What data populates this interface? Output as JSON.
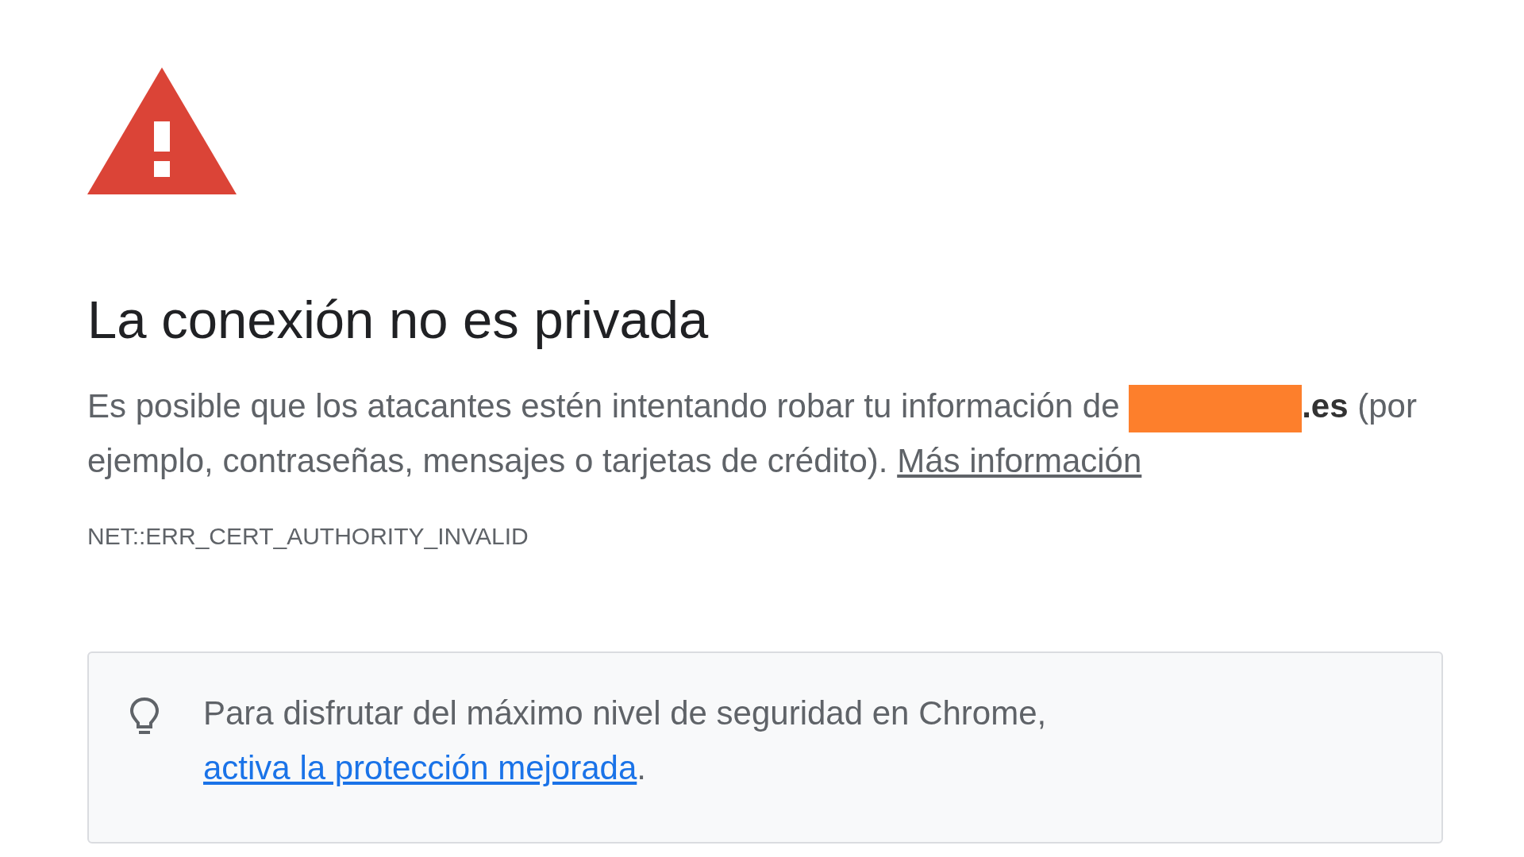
{
  "heading": "La conexión no es privada",
  "message": {
    "before": "Es posible que los atacantes estén intentando robar tu información de",
    "redacted": true,
    "after": "**.es** (por ejemplo, contraseñas, mensajes o tarjetas de crédito).",
    "link": "Más información"
  },
  "error_code": "NET::ERR_CERT_AUTHORITY_INVALID",
  "tip": {
    "text": "Para disfrutar del máximo nivel de seguridad en Chrome,",
    "link": "activa la protección mejorada",
    "end": "."
  }
}
